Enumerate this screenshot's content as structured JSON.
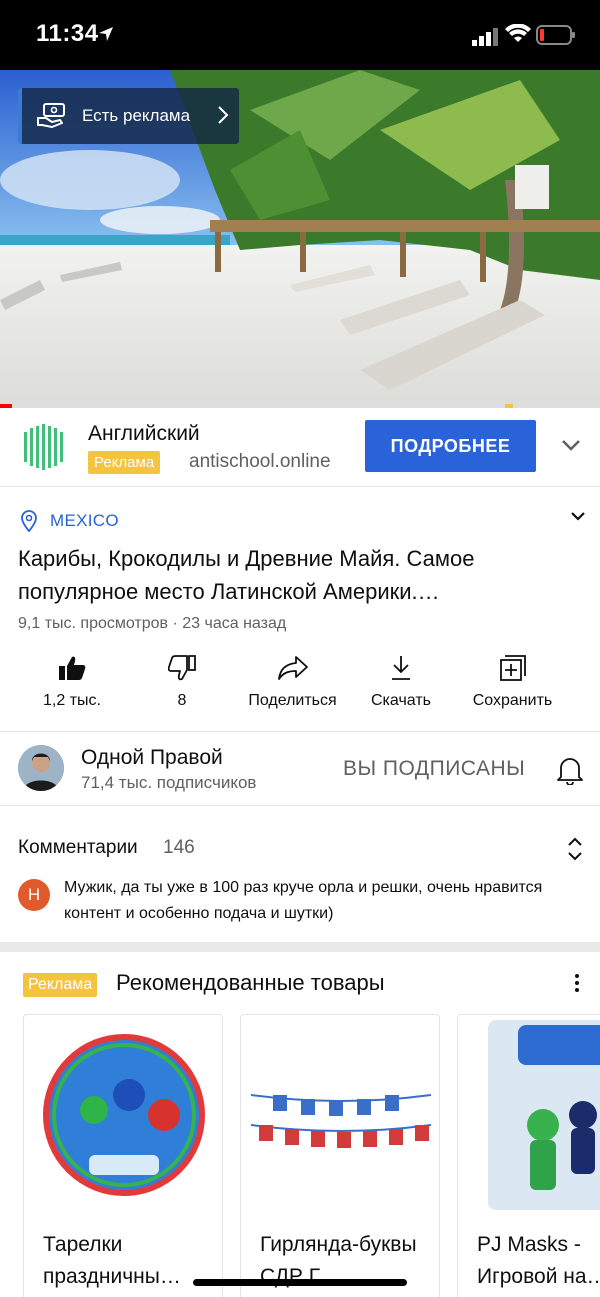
{
  "status_bar": {
    "time": "11:34",
    "battery_color": "#ff3b30"
  },
  "video": {
    "ad_pill_label": "Есть реклама",
    "progress": 0.02
  },
  "ad": {
    "title": "Английский",
    "badge": "Реклама",
    "domain": "antischool.online",
    "cta": "ПОДРОБНЕЕ",
    "logo_color": "#3fbf7a"
  },
  "info": {
    "location": "MEXICO",
    "title": "Карибы, Крокодилы и Древние Майя. Самое популярное место Латинской Америки.…",
    "meta": "9,1 тыс. просмотров · 23 часа назад"
  },
  "actions": [
    {
      "icon": "thumbs-up-icon",
      "label": "1,2 тыс."
    },
    {
      "icon": "thumbs-down-icon",
      "label": "8"
    },
    {
      "icon": "share-icon",
      "label": "Поделиться"
    },
    {
      "icon": "download-icon",
      "label": "Скачать"
    },
    {
      "icon": "save-icon",
      "label": "Сохранить"
    }
  ],
  "channel": {
    "name": "Одной Правой",
    "subscribers": "71,4 тыс. подписчиков",
    "subscribed_label": "ВЫ ПОДПИСАНЫ"
  },
  "comments": {
    "heading": "Комментарии",
    "count": "146",
    "top_comment": {
      "avatar_letter": "Н",
      "avatar_color": "#e05a2b",
      "text": "Мужик, да ты уже в 100 раз круче орла и решки, очень нравится контент и особенно подача и шутки)"
    }
  },
  "products": {
    "badge": "Реклама",
    "heading": "Рекомендованные товары",
    "items": [
      {
        "name": "Тарелки праздничны…"
      },
      {
        "name": "Гирлянда-буквы СДР Г…"
      },
      {
        "name": "PJ Masks - Игровой на…"
      }
    ]
  },
  "colors": {
    "accent": "#2962d9",
    "ad_yellow": "#f4c33f",
    "text_secondary": "#606060"
  }
}
